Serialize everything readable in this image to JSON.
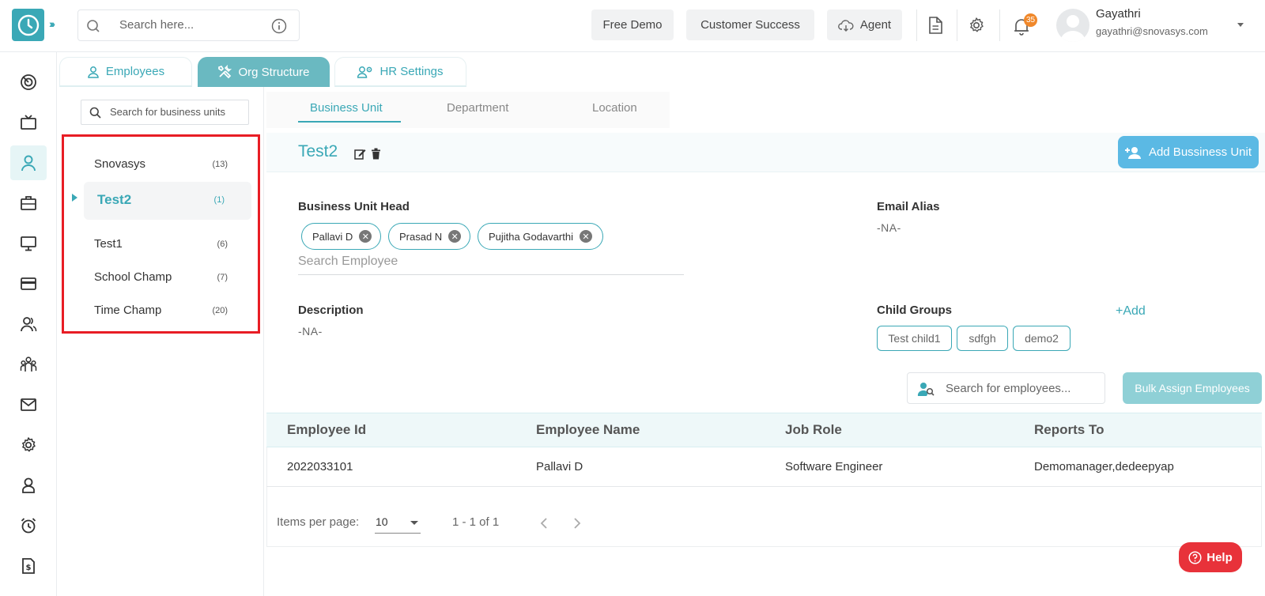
{
  "topbar": {
    "search_placeholder": "Search here...",
    "free_demo": "Free Demo",
    "customer_success": "Customer Success",
    "agent": "Agent",
    "notification_count": "35",
    "user": {
      "name": "Gayathri",
      "email": "gayathri@snovasys.com"
    }
  },
  "module_tabs": [
    {
      "label": "Employees",
      "icon": "person-icon"
    },
    {
      "label": "Org Structure",
      "icon": "tools-icon"
    },
    {
      "label": "HR Settings",
      "icon": "people-gear-icon"
    }
  ],
  "bu_search_placeholder": "Search for business units",
  "business_units": [
    {
      "name": "Snovasys",
      "count": "(13)"
    },
    {
      "name": "Test2",
      "count": "(1)"
    },
    {
      "name": "Test1",
      "count": "(6)"
    },
    {
      "name": "School Champ",
      "count": "(7)"
    },
    {
      "name": "Time Champ",
      "count": "(20)"
    }
  ],
  "sub_tabs": [
    "Business Unit",
    "Department",
    "Location"
  ],
  "detail": {
    "title": "Test2",
    "add_bu_label": "Add Bussiness Unit",
    "head_label": "Business Unit Head",
    "heads": [
      "Pallavi D",
      "Prasad N",
      "Pujitha Godavarthi"
    ],
    "search_employee_placeholder": "Search Employee",
    "email_alias_label": "Email Alias",
    "email_alias_value": "-NA-",
    "description_label": "Description",
    "description_value": "-NA-",
    "child_groups_label": "Child Groups",
    "add_link": "+Add",
    "child_groups": [
      "Test child1",
      "sdfgh",
      "demo2"
    ],
    "employee_search_placeholder": "Search for employees...",
    "bulk_assign_label": "Bulk Assign Employees"
  },
  "table": {
    "columns": [
      "Employee Id",
      "Employee Name",
      "Job Role",
      "Reports To"
    ],
    "rows": [
      [
        "2022033101",
        "Pallavi D",
        "Software Engineer",
        "Demomanager,dedeepyap"
      ]
    ]
  },
  "paginator": {
    "items_per_page_label": "Items per page:",
    "items_per_page_value": "10",
    "range": "1 - 1 of 1"
  },
  "help_label": "Help",
  "colors": {
    "accent": "#3aa8b6",
    "highlight_box": "#e81d25",
    "add_button": "#5bb9e4",
    "help": "#e8323a"
  }
}
